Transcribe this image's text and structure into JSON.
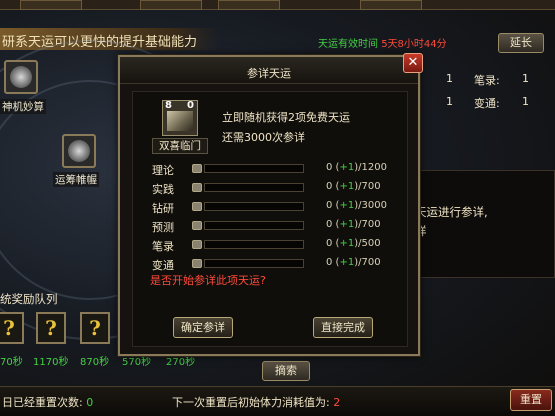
{
  "header": {
    "title": "研系天运可以更快的提升基础能力",
    "status_prefix": "天运有效时间",
    "status_time": "5天8小时44分",
    "extend_button": "延长"
  },
  "skills": [
    {
      "label": "神机妙算"
    },
    {
      "label": "运筹帷幄"
    }
  ],
  "right_stats": [
    {
      "label": "1",
      "name": "笔录:",
      "value": "1"
    },
    {
      "label": "1",
      "name": "变通:",
      "value": "1"
    }
  ],
  "right_box": {
    "line1": "天运进行参详,",
    "line2": "详"
  },
  "rewards": {
    "title": "统奖励队列",
    "slots": [
      "?",
      "?",
      "?"
    ],
    "times": [
      "70秒",
      "1170秒",
      "870秒",
      "570秒",
      "270秒"
    ]
  },
  "view_button": "摘索",
  "bottom": {
    "reset_count_label": "日已经重置次数:",
    "reset_count_value": "0",
    "next_cost_label": "下一次重置后初始体力消耗值为:",
    "next_cost_value": "2",
    "reset_button": "重置"
  },
  "dialog": {
    "title": "参详天运",
    "close": "✕",
    "item": {
      "count_left": "8",
      "count_right": "0",
      "name": "双喜临门"
    },
    "desc_line1": "立即随机获得2项免费天运",
    "desc_line2": "还需3000次参详",
    "attributes": [
      {
        "label": "理论",
        "current": "0",
        "plus": "+1",
        "max": "1200",
        "progress": 0
      },
      {
        "label": "实践",
        "current": "0",
        "plus": "+1",
        "max": "700",
        "progress": 0
      },
      {
        "label": "钻研",
        "current": "0",
        "plus": "+1",
        "max": "3000",
        "progress": 0
      },
      {
        "label": "预测",
        "current": "0",
        "plus": "+1",
        "max": "700",
        "progress": 0
      },
      {
        "label": "笔录",
        "current": "0",
        "plus": "+1",
        "max": "500",
        "progress": 0
      },
      {
        "label": "变通",
        "current": "0",
        "plus": "+1",
        "max": "700",
        "progress": 0
      }
    ],
    "question": "是否开始参详此项天运?",
    "confirm_button": "确定参详",
    "direct_button": "直接完成"
  }
}
